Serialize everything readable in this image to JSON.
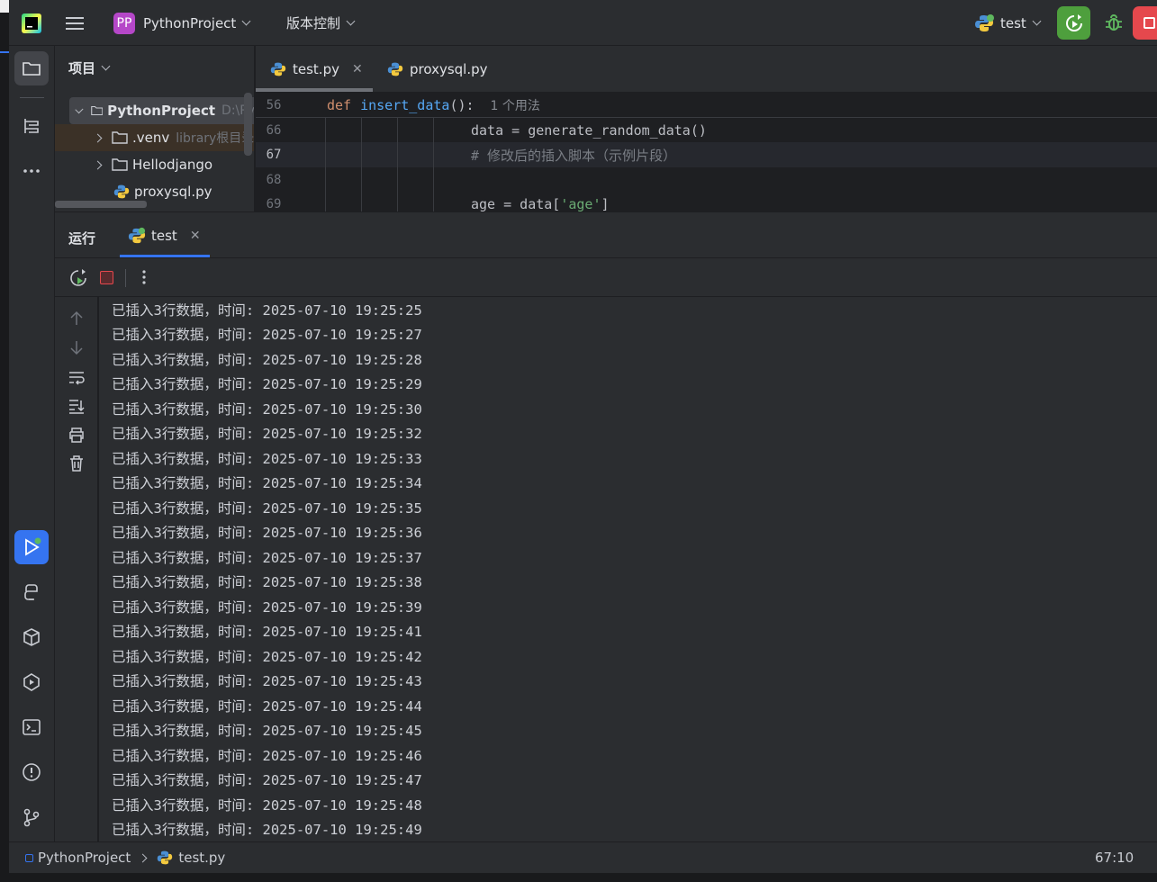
{
  "titlebar": {
    "logo_text": "PC",
    "project_badge": "PP",
    "project_name": "PythonProject",
    "vcs_menu": "版本控制",
    "run_config": "test",
    "colors": {
      "badge": "#b547c8",
      "run_button": "#4e9f3d",
      "stop_button": "#e5484d"
    }
  },
  "project_panel": {
    "title": "项目",
    "items": [
      {
        "label": "PythonProject",
        "extra": "D:\\Py"
      },
      {
        "label": ".venv",
        "extra": "library根目录"
      },
      {
        "label": "Hellodjango"
      },
      {
        "label": "proxysql.py"
      }
    ]
  },
  "editor": {
    "tabs": [
      {
        "label": "test.py"
      },
      {
        "label": "proxysql.py"
      }
    ],
    "breadcrumb_line": {
      "num": "56",
      "kw": "def",
      "fn": "insert_data",
      "rest": "():",
      "usages": "1 个用法"
    },
    "lines": [
      {
        "num": "66",
        "code": "data = generate_random_data()"
      },
      {
        "num": "67",
        "code": "# 修改后的插入脚本（示例片段）"
      },
      {
        "num": "68",
        "code": ""
      },
      {
        "num": "69",
        "code_pre": "age = data[",
        "code_str": "'age'",
        "code_post": "]"
      }
    ]
  },
  "run_panel": {
    "label": "运行",
    "tab": "test",
    "output": [
      "已插入3行数据，时间: 2025-07-10 19:25:25",
      "已插入3行数据，时间: 2025-07-10 19:25:27",
      "已插入3行数据，时间: 2025-07-10 19:25:28",
      "已插入3行数据，时间: 2025-07-10 19:25:29",
      "已插入3行数据，时间: 2025-07-10 19:25:30",
      "已插入3行数据，时间: 2025-07-10 19:25:32",
      "已插入3行数据，时间: 2025-07-10 19:25:33",
      "已插入3行数据，时间: 2025-07-10 19:25:34",
      "已插入3行数据，时间: 2025-07-10 19:25:35",
      "已插入3行数据，时间: 2025-07-10 19:25:36",
      "已插入3行数据，时间: 2025-07-10 19:25:37",
      "已插入3行数据，时间: 2025-07-10 19:25:38",
      "已插入3行数据，时间: 2025-07-10 19:25:39",
      "已插入3行数据，时间: 2025-07-10 19:25:41",
      "已插入3行数据，时间: 2025-07-10 19:25:42",
      "已插入3行数据，时间: 2025-07-10 19:25:43",
      "已插入3行数据，时间: 2025-07-10 19:25:44",
      "已插入3行数据，时间: 2025-07-10 19:25:45",
      "已插入3行数据，时间: 2025-07-10 19:25:46",
      "已插入3行数据，时间: 2025-07-10 19:25:47",
      "已插入3行数据，时间: 2025-07-10 19:25:48",
      "已插入3行数据，时间: 2025-07-10 19:25:49"
    ]
  },
  "statusbar": {
    "project": "PythonProject",
    "file": "test.py",
    "position": "67:10"
  }
}
